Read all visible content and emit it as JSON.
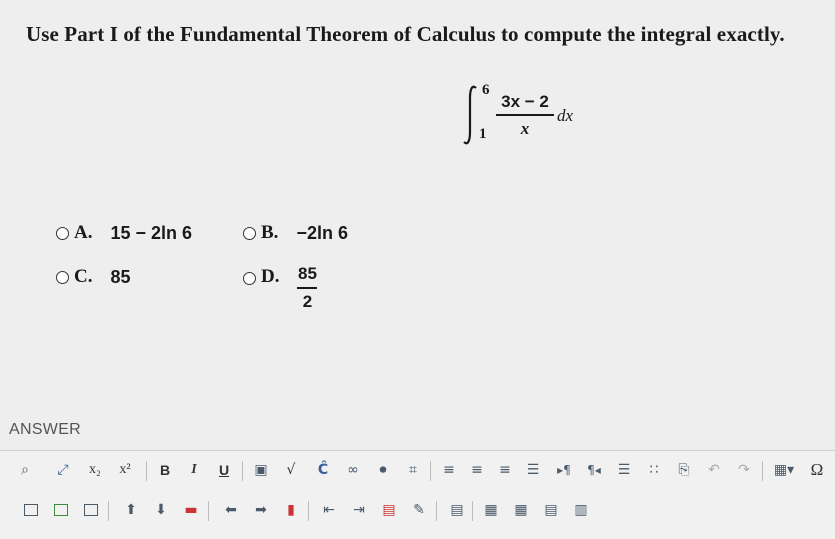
{
  "question": "Use Part I of the Fundamental Theorem of Calculus to compute the integral exactly.",
  "integral": {
    "upper": "6",
    "lower": "1",
    "numerator": "3x − 2",
    "denominator": "x",
    "differential": "dx"
  },
  "options": [
    {
      "letter": "A.",
      "value": "15 − 2ln 6"
    },
    {
      "letter": "B.",
      "value": "−2ln 6"
    },
    {
      "letter": "C.",
      "value": "85"
    },
    {
      "letter": "D.",
      "numerator": "85",
      "denominator": "2"
    }
  ],
  "answer_label": "ANSWER",
  "toolbar": {
    "subscript": "x₂",
    "superscript": "x²",
    "bold": "B",
    "italic": "I",
    "underline": "U",
    "omega": "Ω"
  }
}
